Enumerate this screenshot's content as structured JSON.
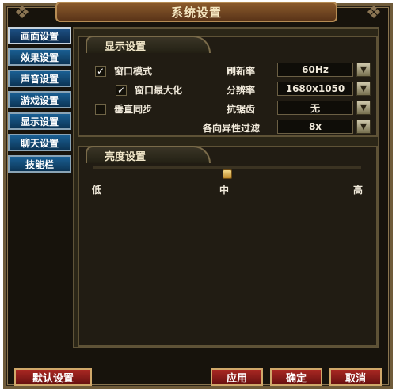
{
  "window": {
    "title": "系统设置"
  },
  "sidebar": {
    "items": [
      {
        "label": "画面设置",
        "active": true
      },
      {
        "label": "效果设置"
      },
      {
        "label": "声音设置"
      },
      {
        "label": "游戏设置"
      },
      {
        "label": "显示设置"
      },
      {
        "label": "聊天设置"
      },
      {
        "label": "技能栏"
      }
    ]
  },
  "display": {
    "tab": "显示设置",
    "window_mode": {
      "label": "窗口模式",
      "checked": true
    },
    "window_maximize": {
      "label": "窗口最大化",
      "checked": true
    },
    "vsync": {
      "label": "垂直同步",
      "checked": false
    },
    "refresh_rate": {
      "label": "刷新率",
      "value": "60Hz"
    },
    "resolution": {
      "label": "分辨率",
      "value": "1680x1050"
    },
    "antialias": {
      "label": "抗锯齿",
      "value": "无"
    },
    "anisotropic": {
      "label": "各向异性过滤",
      "value": "8x"
    }
  },
  "brightness": {
    "tab": "亮度设置",
    "low": "低",
    "mid": "中",
    "high": "高",
    "value": 0.5
  },
  "buttons": {
    "default": "默认设置",
    "apply": "应用",
    "ok": "确定",
    "cancel": "取消"
  },
  "icons": {
    "checkmark": "✓",
    "dropdown": "chevron-down"
  },
  "colors": {
    "background": "#17130c",
    "tab_blue": "#1a5f93",
    "button_red": "#a92822",
    "text": "#f1eadb"
  }
}
